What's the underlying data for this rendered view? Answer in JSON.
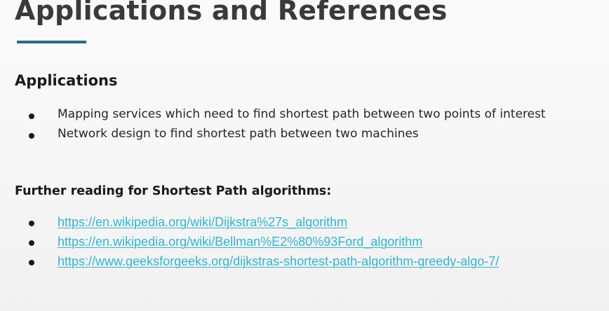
{
  "slide": {
    "title": "Applications and References",
    "applications": {
      "heading": "Applications",
      "items": [
        "Mapping services which need to find shortest path between two points of interest",
        "Network design to find shortest path between two machines"
      ]
    },
    "further_reading": {
      "heading": "Further reading for Shortest Path algorithms:",
      "links": [
        "https://en.wikipedia.org/wiki/Dijkstra%27s_algorithm",
        "https://en.wikipedia.org/wiki/Bellman%E2%80%93Ford_algorithm",
        "https://www.geeksforgeeks.org/dijkstras-shortest-path-algorithm-greedy-algo-7/"
      ]
    }
  },
  "colors": {
    "title": "#3a3a3a",
    "underline_accent": "#2f6b7a",
    "link": "#34b4cf",
    "text": "#262626"
  }
}
